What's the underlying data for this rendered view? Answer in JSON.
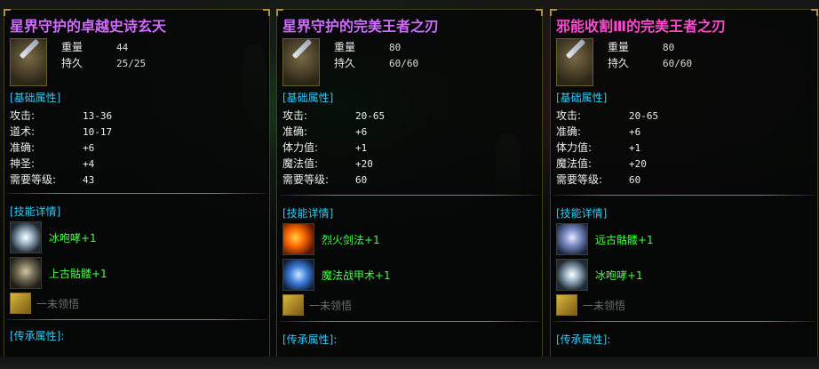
{
  "panels": [
    {
      "title": "星界守护的卓越史诗玄天",
      "weight_label": "重量",
      "weight": "44",
      "durability_label": "持久",
      "durability": "25/25",
      "base_section": "[基础属性]",
      "attributes": [
        {
          "k": "攻击:",
          "v": "13-36"
        },
        {
          "k": "道术:",
          "v": "10-17"
        },
        {
          "k": "准确:",
          "v": "+6"
        },
        {
          "k": "神圣:",
          "v": "+4"
        },
        {
          "k": "需要等级:",
          "v": "43"
        }
      ],
      "skill_section": "[技能详情]",
      "skills": [
        {
          "name": "冰咆哮+1",
          "icon": "frost-roar-icon"
        },
        {
          "name": "上古骷髅+1",
          "icon": "skeleton-icon"
        }
      ],
      "unrealized": "一未领悟",
      "inherit_section": "[传承属性]:"
    },
    {
      "title": "星界守护的完美王者之刃",
      "weight_label": "重量",
      "weight": "80",
      "durability_label": "持久",
      "durability": "60/60",
      "base_section": "[基础属性]",
      "attributes": [
        {
          "k": "攻击:",
          "v": "20-65"
        },
        {
          "k": "准确:",
          "v": "+6"
        },
        {
          "k": "体力值:",
          "v": "+1"
        },
        {
          "k": "魔法值:",
          "v": "+20"
        },
        {
          "k": "需要等级:",
          "v": "60"
        }
      ],
      "skill_section": "[技能详情]",
      "skills": [
        {
          "name": "烈火剑法+1",
          "icon": "fire-sword-icon"
        },
        {
          "name": "魔法战甲术+1",
          "icon": "magic-armor-icon"
        }
      ],
      "unrealized": "一未领悟",
      "inherit_section": "[传承属性]:"
    },
    {
      "title": "邪能收割Ⅲ的完美王者之刃",
      "weight_label": "重量",
      "weight": "80",
      "durability_label": "持久",
      "durability": "60/60",
      "base_section": "[基础属性]",
      "attributes": [
        {
          "k": "攻击:",
          "v": "20-65"
        },
        {
          "k": "准确:",
          "v": "+6"
        },
        {
          "k": "体力值:",
          "v": "+1"
        },
        {
          "k": "魔法值:",
          "v": "+20"
        },
        {
          "k": "需要等级:",
          "v": "60"
        }
      ],
      "skill_section": "[技能详情]",
      "skills": [
        {
          "name": "远古骷髅+1",
          "icon": "ancient-skeleton-icon"
        },
        {
          "name": "冰咆哮+1",
          "icon": "frost-roar-icon"
        }
      ],
      "unrealized": "一未领悟",
      "inherit_section": "[传承属性]:"
    }
  ],
  "colors": {
    "title_purple": "#d06cff",
    "title_pink": "#ff4ad0",
    "section_cyan": "#35c8f0",
    "skill_green": "#44ff44",
    "border_gold": "#9a7b35"
  }
}
